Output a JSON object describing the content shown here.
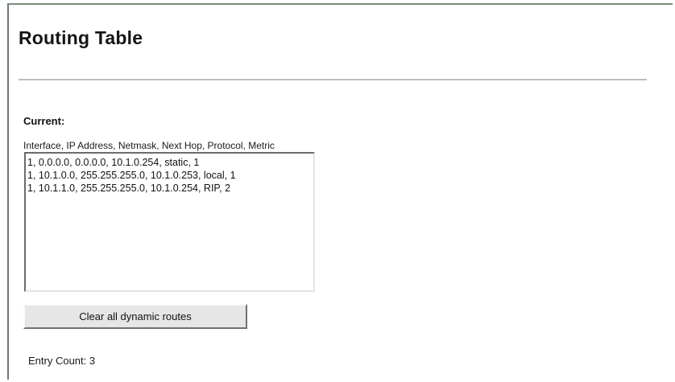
{
  "page": {
    "title": "Routing Table"
  },
  "current": {
    "label": "Current:",
    "columns": "Interface, IP Address, Netmask, Next Hop, Protocol, Metric",
    "routes": [
      "1, 0.0.0.0, 0.0.0.0, 10.1.0.254, static, 1",
      "1, 10.1.0.0, 255.255.255.0, 10.1.0.253, local, 1",
      "1, 10.1.1.0, 255.255.255.0, 10.1.0.254, RIP, 2"
    ]
  },
  "actions": {
    "clear_label": "Clear all dynamic routes"
  },
  "footer": {
    "entry_count": "Entry Count: 3"
  }
}
